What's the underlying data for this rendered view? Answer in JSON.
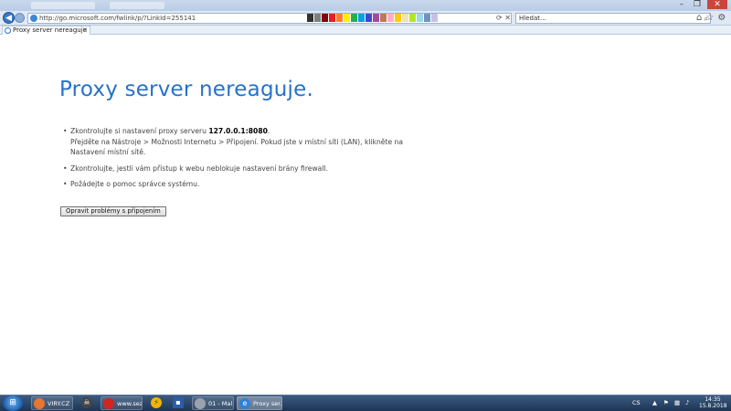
{
  "browser": {
    "address_url": "http://go.microsoft.com/fwlink/p/?LinkId=255141",
    "search_placeholder": "Hledat...",
    "tab_title": "Proxy server nereaguje",
    "palette": [
      "#333333",
      "#7f7f7f",
      "#880015",
      "#ed1c24",
      "#ff7f27",
      "#fff200",
      "#22b14c",
      "#00a2e8",
      "#3f48cc",
      "#a349a4",
      "#b97a57",
      "#ffaec9",
      "#ffc90e",
      "#efe4b0",
      "#b5e61d",
      "#99d9ea",
      "#7092be",
      "#c8bfe7"
    ]
  },
  "page": {
    "heading": "Proxy server nereaguje.",
    "tips": [
      {
        "line1_prefix": "Zkontrolujte si nastavení proxy serveru ",
        "proxy": "127.0.0.1:8080",
        "line1_suffix": ".",
        "line2": "Přejděte na Nástroje > Možnosti Internetu > Připojení. Pokud jste v místní síti (LAN), klikněte na Nastavení místní sítě."
      },
      {
        "text": "Zkontrolujte, jestli vám přístup k webu neblokuje nastavení brány firewall."
      },
      {
        "text": "Požádejte o pomoc správce systému."
      }
    ],
    "repair_button": "Opravit problémy s připojením"
  },
  "taskbar": {
    "items": [
      {
        "label": "VIRY.CZ •..."
      },
      {
        "label": "www.sez..."
      },
      {
        "label": "01 - Mal..."
      },
      {
        "label": "Proxy ser..."
      }
    ],
    "lang": "CS",
    "time": "14:35",
    "date": "15.8.2018"
  }
}
